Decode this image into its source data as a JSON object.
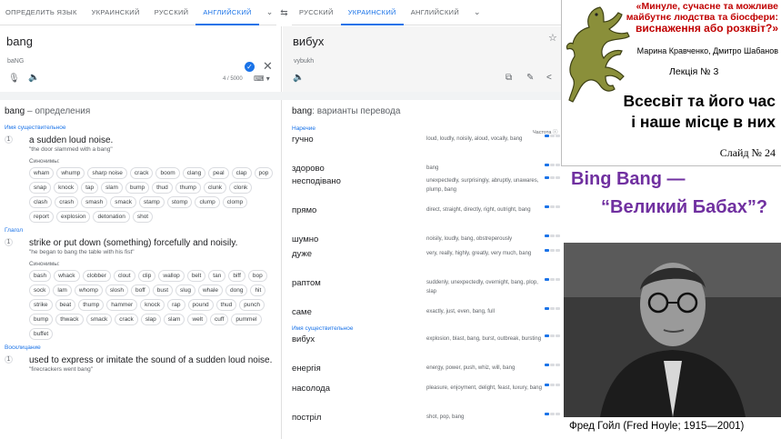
{
  "translate": {
    "source_langs": [
      "ОПРЕДЕЛИТЬ ЯЗЫК",
      "УКРАИНСКИЙ",
      "РУССКИЙ",
      "АНГЛИЙСКИЙ"
    ],
    "target_langs": [
      "РУССКИЙ",
      "УКРАИНСКИЙ",
      "АНГЛИЙСКИЙ"
    ],
    "source_text": "bang",
    "source_translit": "baNG",
    "char_count": "4 / 5000",
    "target_text": "вибух",
    "target_translit": "vybukh",
    "icons": {
      "swap": "swap-icon",
      "chevron": "chevron-down-icon",
      "check": "check-icon",
      "close": "close-icon",
      "mic": "mic-icon",
      "speaker": "speaker-icon",
      "keyboard": "keyboard-icon",
      "star": "star-icon",
      "copy": "copy-icon",
      "edit": "edit-icon",
      "share": "share-icon"
    },
    "accent_color": "#1a73e8"
  },
  "definitions": {
    "word": "bang",
    "title_suffix": " – определения",
    "synonyms_label": "Синонимы:",
    "groups": [
      {
        "pos": "Имя существительное",
        "senses": [
          {
            "num": "1",
            "gloss": "a sudden loud noise.",
            "example": "\"the door slammed with a bang\"",
            "synonyms": [
              "wham",
              "whump",
              "sharp noise",
              "crack",
              "boom",
              "clang",
              "peal",
              "clap",
              "pop",
              "snap",
              "knock",
              "tap",
              "slam",
              "bump",
              "thud",
              "thump",
              "clunk",
              "clonk",
              "clash",
              "crash",
              "smash",
              "smack",
              "stamp",
              "stomp",
              "clump",
              "clomp",
              "report",
              "explosion",
              "detonation",
              "shot"
            ]
          }
        ]
      },
      {
        "pos": "Глагол",
        "senses": [
          {
            "num": "1",
            "gloss": "strike or put down (something) forcefully and noisily.",
            "example": "\"he began to bang the table with his fist\"",
            "synonyms": [
              "bash",
              "whack",
              "clobber",
              "clout",
              "clip",
              "wallop",
              "belt",
              "tan",
              "biff",
              "bop",
              "sock",
              "lam",
              "whomp",
              "slosh",
              "boff",
              "bust",
              "slug",
              "whale",
              "dong",
              "hit",
              "strike",
              "beat",
              "thump",
              "hammer",
              "knock",
              "rap",
              "pound",
              "thud",
              "punch",
              "bump",
              "thwack",
              "smack",
              "crack",
              "slap",
              "slam",
              "welt",
              "cuff",
              "pummel",
              "buffet"
            ]
          }
        ]
      },
      {
        "pos": "Восклицание",
        "senses": [
          {
            "num": "1",
            "gloss": "used to express or imitate the sound of a sudden loud noise.",
            "example": "\"firecrackers went bang\"",
            "synonyms": []
          }
        ]
      }
    ]
  },
  "translations": {
    "word": "bang",
    "title_suffix": ": варианты перевода",
    "freq_header": "Частота ⓘ",
    "groups": [
      {
        "pos": "Наречие",
        "rows": [
          {
            "word": "гучно",
            "syn": "loud, loudly, noisily, aloud, vocally, bang",
            "freq": 1
          },
          {
            "word": "здорово",
            "syn": "bang",
            "freq": 1
          },
          {
            "word": "несподівано",
            "syn": "unexpectedly, surprisingly, abruptly, unawares, plump, bang",
            "freq": 1
          },
          {
            "word": "прямо",
            "syn": "direct, straight, directly, right, outright, bang",
            "freq": 1
          },
          {
            "word": "шумно",
            "syn": "noisily, loudly, bang, obstreperously",
            "freq": 1
          },
          {
            "word": "дуже",
            "syn": "very, really, highly, greatly, very much, bang",
            "freq": 1
          },
          {
            "word": "раптом",
            "syn": "suddenly, unexpectedly, overnight, bang, plop, slap",
            "freq": 1
          },
          {
            "word": "саме",
            "syn": "exactly, just, even, bang, full",
            "freq": 1
          }
        ]
      },
      {
        "pos": "Имя существительное",
        "rows": [
          {
            "word": "вибух",
            "syn": "explosion, blast, bang, burst, outbreak, bursting",
            "freq": 1
          },
          {
            "word": "енергія",
            "syn": "energy, power, push, whiz, will, bang",
            "freq": 1
          },
          {
            "word": "насолода",
            "syn": "pleasure, enjoyment, delight, feast, luxury, bang",
            "freq": 1
          },
          {
            "word": "постріл",
            "syn": "shot, pop, bang",
            "freq": 1
          }
        ]
      }
    ]
  },
  "slide": {
    "quote_lines": [
      "«Минуле, сучасне та можливе",
      "майбутнє людства та біосфери:",
      "виснаження або розквіт?»"
    ],
    "authors": "Марина Кравченко, Дмитро Шабанов",
    "lecture": "Лекція № 3",
    "title_lines": [
      "Всесвіт та його час",
      "і наше місце в них"
    ],
    "slide_number": "Слайд № 24",
    "heading_line1": "Bing Bang —",
    "heading_line2": "“Великий Бабах”?",
    "caption": "Фред Гойл (Fred Hoyle; 1915—2001)",
    "logo_icon": "lizard-icon",
    "quote_color": "#c00000",
    "heading_color": "#7030a0"
  }
}
